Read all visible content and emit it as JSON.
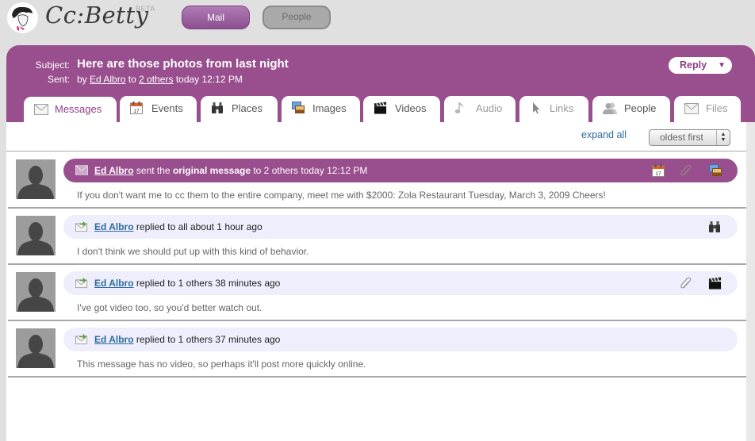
{
  "app": {
    "logo_text": "Cc:Betty",
    "beta_label": "BETA",
    "nav": [
      {
        "label": "Mail",
        "active": true
      },
      {
        "label": "People",
        "active": false
      }
    ]
  },
  "thread": {
    "subject_label": "Subject:",
    "subject": "Here are those photos from last night",
    "sent_label": "Sent:",
    "sent": {
      "prefix": "by",
      "sender": "Ed Albro",
      "to_word": "to",
      "recipients": "2 others",
      "when": "today 12:12 PM"
    },
    "reply_button": "Reply",
    "reply_caret": "▼"
  },
  "tabs": [
    {
      "label": "Messages",
      "icon": "envelope-icon",
      "active": true,
      "enabled": true
    },
    {
      "label": "Events",
      "icon": "calendar-icon",
      "active": false,
      "enabled": true
    },
    {
      "label": "Places",
      "icon": "binoculars-icon",
      "active": false,
      "enabled": true
    },
    {
      "label": "Images",
      "icon": "images-icon",
      "active": false,
      "enabled": true
    },
    {
      "label": "Videos",
      "icon": "clapperboard-icon",
      "active": false,
      "enabled": true
    },
    {
      "label": "Audio",
      "icon": "music-note-icon",
      "active": false,
      "enabled": false
    },
    {
      "label": "Links",
      "icon": "cursor-icon",
      "active": false,
      "enabled": false
    },
    {
      "label": "People",
      "icon": "person-icon",
      "active": false,
      "enabled": true
    },
    {
      "label": "Files",
      "icon": "envelope-icon",
      "active": false,
      "enabled": false
    }
  ],
  "toolbar": {
    "expand_all": "expand all",
    "sort_selected": "oldest first"
  },
  "messages": [
    {
      "type": "original",
      "sender": "Ed Albro",
      "action_pre": "sent the",
      "action_bold": "original message",
      "action_post": "to 2 others today 12:12 PM",
      "body": "If you don't want me to cc them to the entire company, meet me with $2000: Zola Restaurant Tuesday, March 3, 2009 Cheers!",
      "attachments": [
        "calendar-icon",
        "paperclip-icon",
        "images-icon"
      ]
    },
    {
      "type": "reply",
      "sender": "Ed Albro",
      "action": "replied to all about 1 hour ago",
      "body": "I don't think we should put up with this kind of behavior.",
      "attachments": [
        "binoculars-icon"
      ]
    },
    {
      "type": "reply",
      "sender": "Ed Albro",
      "action": "replied to 1 others 38 minutes ago",
      "body": "I've got video too, so you'd better watch out.",
      "attachments": [
        "paperclip-icon",
        "clapperboard-icon"
      ]
    },
    {
      "type": "reply",
      "sender": "Ed Albro",
      "action": "replied to 1 others 37 minutes ago",
      "body": "This message has no video, so perhaps it'll post more quickly online.",
      "attachments": []
    }
  ],
  "colors": {
    "brand_purple": "#994e8e",
    "link_blue": "#2d6b9f",
    "reply_bubble": "#efeefc"
  }
}
